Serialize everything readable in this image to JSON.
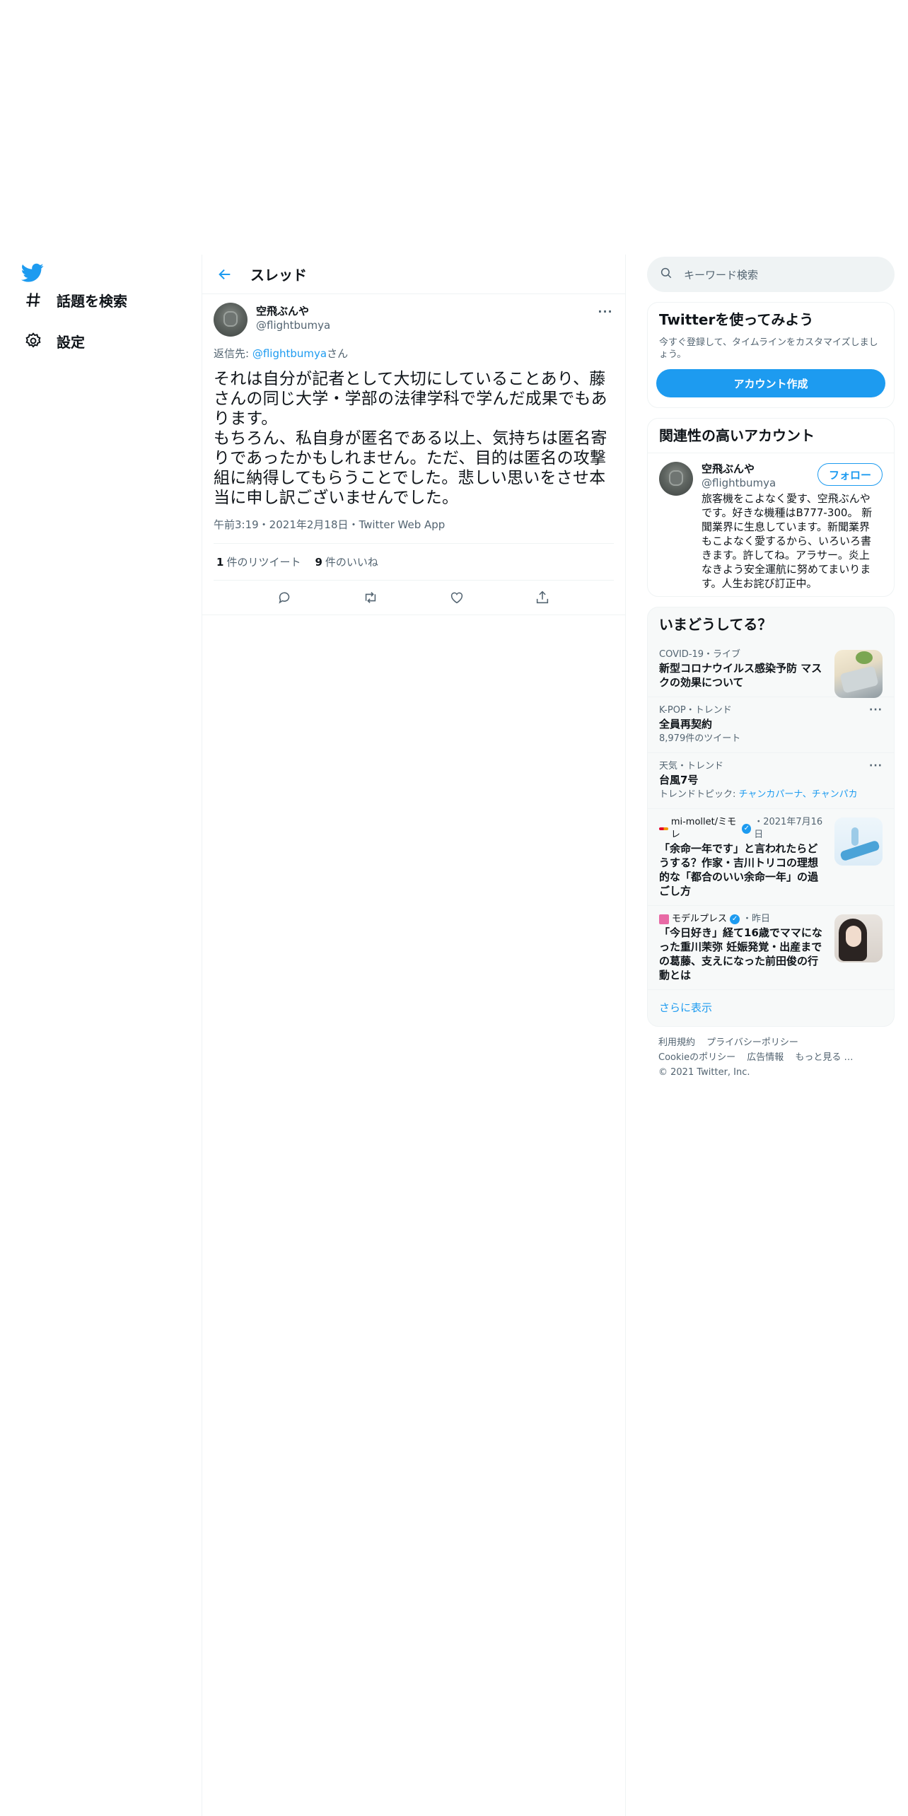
{
  "nav": {
    "explore_label": "話題を検索",
    "settings_label": "設定"
  },
  "header": {
    "title": "スレッド"
  },
  "tweet": {
    "display_name": "空飛ぶんや",
    "handle": "@flightbumya",
    "reply_prefix": "返信先: ",
    "reply_mention": "@flightbumya",
    "reply_suffix": "さん",
    "text": "それは自分が記者として大切にしていることあり、藤さんの同じ大学・学部の法律学科で学んだ成果でもあります。\nもちろん、私自身が匿名である以上、気持ちは匿名寄りであったかもしれません。ただ、目的は匿名の攻撃組に納得してもらうことでした。悲しい思いをさせ本当に申し訳ございませんでした。",
    "meta": "午前3:19・2021年2月18日・Twitter Web App",
    "retweet_count": "1",
    "retweet_label": "件のリツイート",
    "like_count": "9",
    "like_label": "件のいいね"
  },
  "search": {
    "placeholder": "キーワード検索"
  },
  "signup": {
    "title": "Twitterを使ってみよう",
    "desc": "今すぐ登録して、タイムラインをカスタマイズしましょう。",
    "button": "アカウント作成"
  },
  "related": {
    "title": "関連性の高いアカウント",
    "name": "空飛ぶんや",
    "handle": "@flightbumya",
    "bio": "旅客機をこよなく愛す、空飛ぶんやです。好きな機種はB777-300。 新聞業界に生息しています。新聞業界もこよなく愛するから、いろいろ書きます。許してね。アラサー。炎上なきよう安全運航に努めてまいります。人生お詫び訂正中。",
    "follow": "フォロー"
  },
  "trends": {
    "title": "いまどうしてる？",
    "items": [
      {
        "meta": "COVID-19・ライブ",
        "title": "新型コロナウイルス感染予防 マスクの効果について"
      },
      {
        "meta": "K-POP・トレンド",
        "title": "全員再契約",
        "sub": "8,979件のツイート"
      },
      {
        "meta": "天気・トレンド",
        "title": "台風7号",
        "sub_prefix": "トレンドトピック: ",
        "sub_topics": "チャンカパーナ、チャンパカ"
      },
      {
        "publisher": "mi-mollet/ミモレ",
        "date": "・2021年7月16日",
        "title": "「余命一年です」と言われたらどうする？作家・吉川トリコの理想的な「都合のいい余命一年」の過ごし方"
      },
      {
        "publisher": "モデルプレス",
        "date": "・昨日",
        "title": "「今日好き」経て16歳でママになった重川茉弥 妊娠発覚・出産までの葛藤、支えになった前田俊の行動とは"
      }
    ],
    "show_more": "さらに表示"
  },
  "footer": {
    "terms": "利用規約",
    "privacy": "プライバシーポリシー",
    "cookie": "Cookieのポリシー",
    "ads": "広告情報",
    "more": "もっと見る …",
    "copyright": "© 2021 Twitter, Inc."
  },
  "colors": {
    "accent": "#1d9bf0",
    "text_primary": "#0f1419",
    "text_secondary": "#536471",
    "border": "#eff3f4"
  }
}
